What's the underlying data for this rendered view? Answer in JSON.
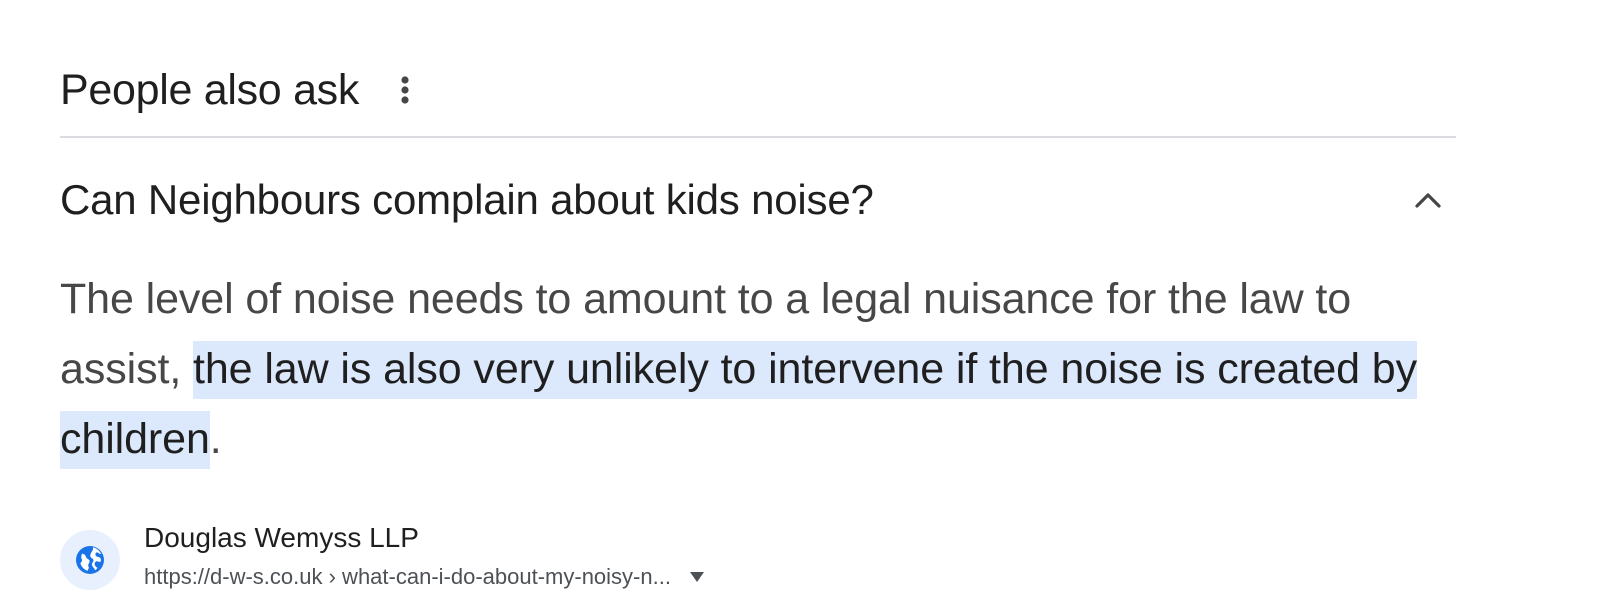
{
  "people_also_ask": {
    "title": "People also ask",
    "more_icon": "more-vert-icon",
    "question": {
      "text": "Can Neighbours complain about kids noise?",
      "toggle_icon": "chevron-up-icon",
      "expanded": true
    },
    "answer": {
      "before": "The level of noise needs to amount to a legal nuisance for the law to assist, ",
      "highlighted": "the law is also very unlikely to intervene if the noise is created by children",
      "after": "."
    },
    "source": {
      "icon": "globe-icon",
      "name": "Douglas Wemyss LLP",
      "url": "https://d-w-s.co.uk › what-can-i-do-about-my-noisy-n...",
      "dropdown_icon": "caret-down-icon"
    }
  },
  "colors": {
    "highlight": "#dce8fc",
    "favicon_bg": "#e8f0fe",
    "favicon": "#1a73e8",
    "divider": "#dadce0"
  }
}
